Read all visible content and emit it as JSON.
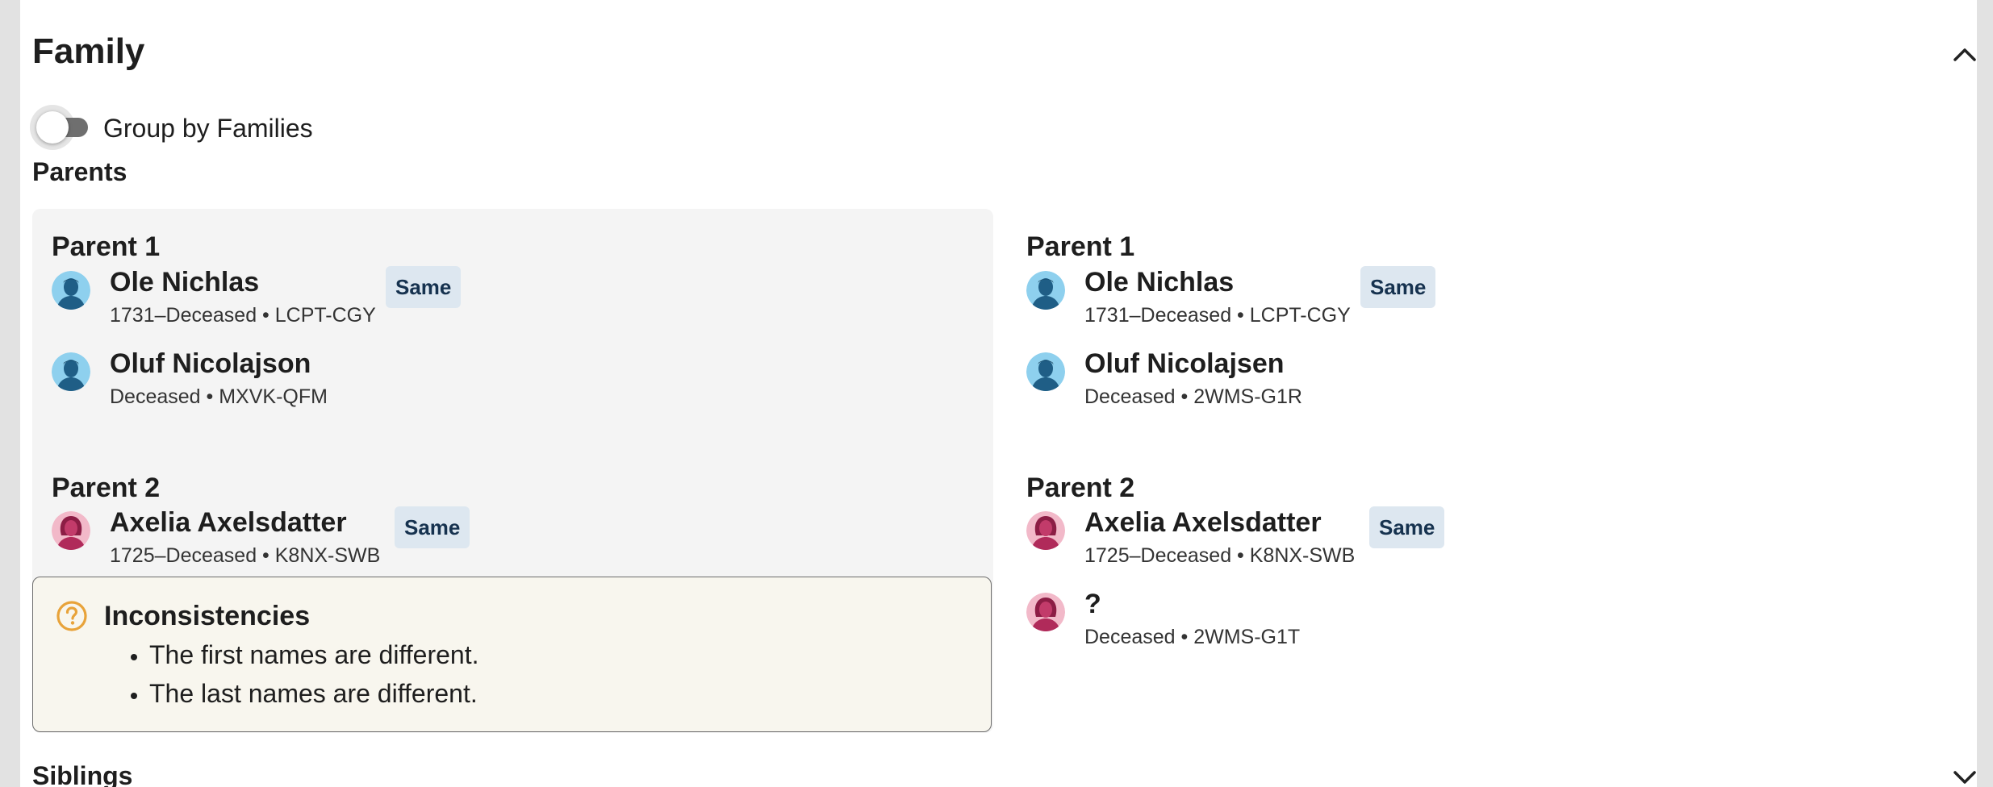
{
  "section": {
    "title": "Family",
    "toggle_label": "Group by Families",
    "parents_heading": "Parents",
    "siblings_heading": "Siblings"
  },
  "left": {
    "parent1": {
      "label": "Parent 1",
      "persons": [
        {
          "name": "Ole Nichlas",
          "meta": "1731–Deceased • LCPT-CGY",
          "badge": "Same",
          "gender": "male"
        },
        {
          "name": "Oluf Nicolajson",
          "meta": "Deceased • MXVK-QFM",
          "gender": "male"
        }
      ]
    },
    "parent2": {
      "label": "Parent 2",
      "persons": [
        {
          "name": "Axelia Axelsdatter",
          "meta": "1725–Deceased • K8NX-SWB",
          "badge": "Same",
          "gender": "female"
        }
      ]
    },
    "inconsistencies": {
      "title": "Inconsistencies",
      "items": [
        "The first names are different.",
        "The last names are different."
      ]
    }
  },
  "right": {
    "parent1": {
      "label": "Parent 1",
      "persons": [
        {
          "name": "Ole Nichlas",
          "meta": "1731–Deceased • LCPT-CGY",
          "badge": "Same",
          "gender": "male"
        },
        {
          "name": "Oluf Nicolajsen",
          "meta": "Deceased • 2WMS-G1R",
          "gender": "male"
        }
      ]
    },
    "parent2": {
      "label": "Parent 2",
      "persons": [
        {
          "name": "Axelia Axelsdatter",
          "meta": "1725–Deceased • K8NX-SWB",
          "badge": "Same",
          "gender": "female"
        },
        {
          "name": "?",
          "meta": "Deceased • 2WMS-G1T",
          "gender": "female"
        }
      ]
    }
  },
  "colors": {
    "badge_bg": "#dde7f0",
    "badge_text": "#16324f",
    "warning_icon": "#e8a33a",
    "male_avatar_bg": "#8ed0ee",
    "female_avatar_bg": "#f2b9c9"
  },
  "icons": {
    "collapse": "chevron-up-icon",
    "expand": "chevron-down-icon",
    "warning": "question-circle-icon",
    "male": "male-avatar-icon",
    "female": "female-avatar-icon"
  }
}
